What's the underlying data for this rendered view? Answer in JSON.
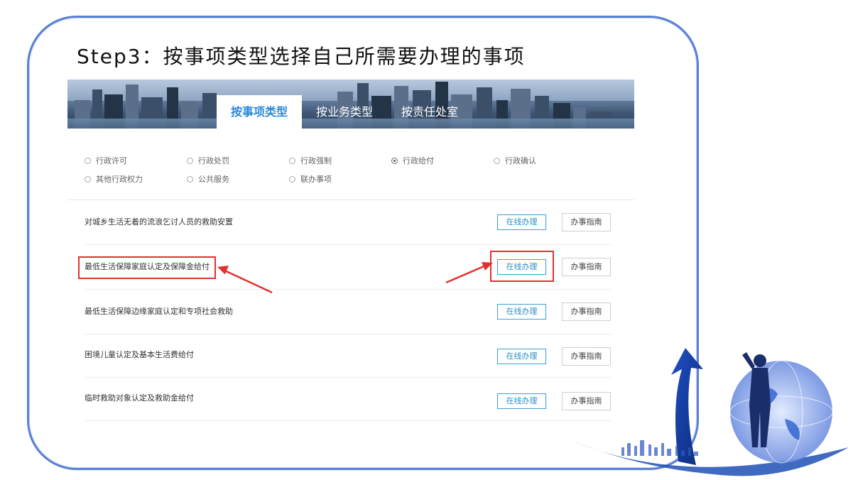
{
  "slide": {
    "title": "Step3：按事项类型选择自己所需要办理的事项"
  },
  "tabs": [
    {
      "label": "按事项类型",
      "active": true
    },
    {
      "label": "按业务类型",
      "active": false
    },
    {
      "label": "按责任处室",
      "active": false
    }
  ],
  "filters": [
    {
      "label": "行政许可",
      "checked": false
    },
    {
      "label": "行政处罚",
      "checked": false
    },
    {
      "label": "行政强制",
      "checked": false
    },
    {
      "label": "行政给付",
      "checked": true
    },
    {
      "label": "行政确认",
      "checked": false
    },
    {
      "label": "其他行政权力",
      "checked": false
    },
    {
      "label": "公共服务",
      "checked": false
    },
    {
      "label": "联办事项",
      "checked": false
    }
  ],
  "items": [
    {
      "name": "对城乡生活无着的流浪乞讨人员的救助安置",
      "online": "在线办理",
      "guide": "办事指南"
    },
    {
      "name": "最低生活保障家庭认定及保障金给付",
      "online": "在线办理",
      "guide": "办事指南"
    },
    {
      "name": "最低生活保障边缘家庭认定和专项社会救助",
      "online": "在线办理",
      "guide": "办事指南"
    },
    {
      "name": "困境儿童认定及基本生活费给付",
      "online": "在线办理",
      "guide": "办事指南"
    },
    {
      "name": "临时救助对象认定及救助金给付",
      "online": "在线办理",
      "guide": "办事指南"
    }
  ],
  "colors": {
    "accent": "#2b88d9",
    "highlight": "#e03131",
    "frame": "#5a7fd6"
  },
  "icons": [
    "arrow-icon",
    "businessman-globe-illustration"
  ]
}
